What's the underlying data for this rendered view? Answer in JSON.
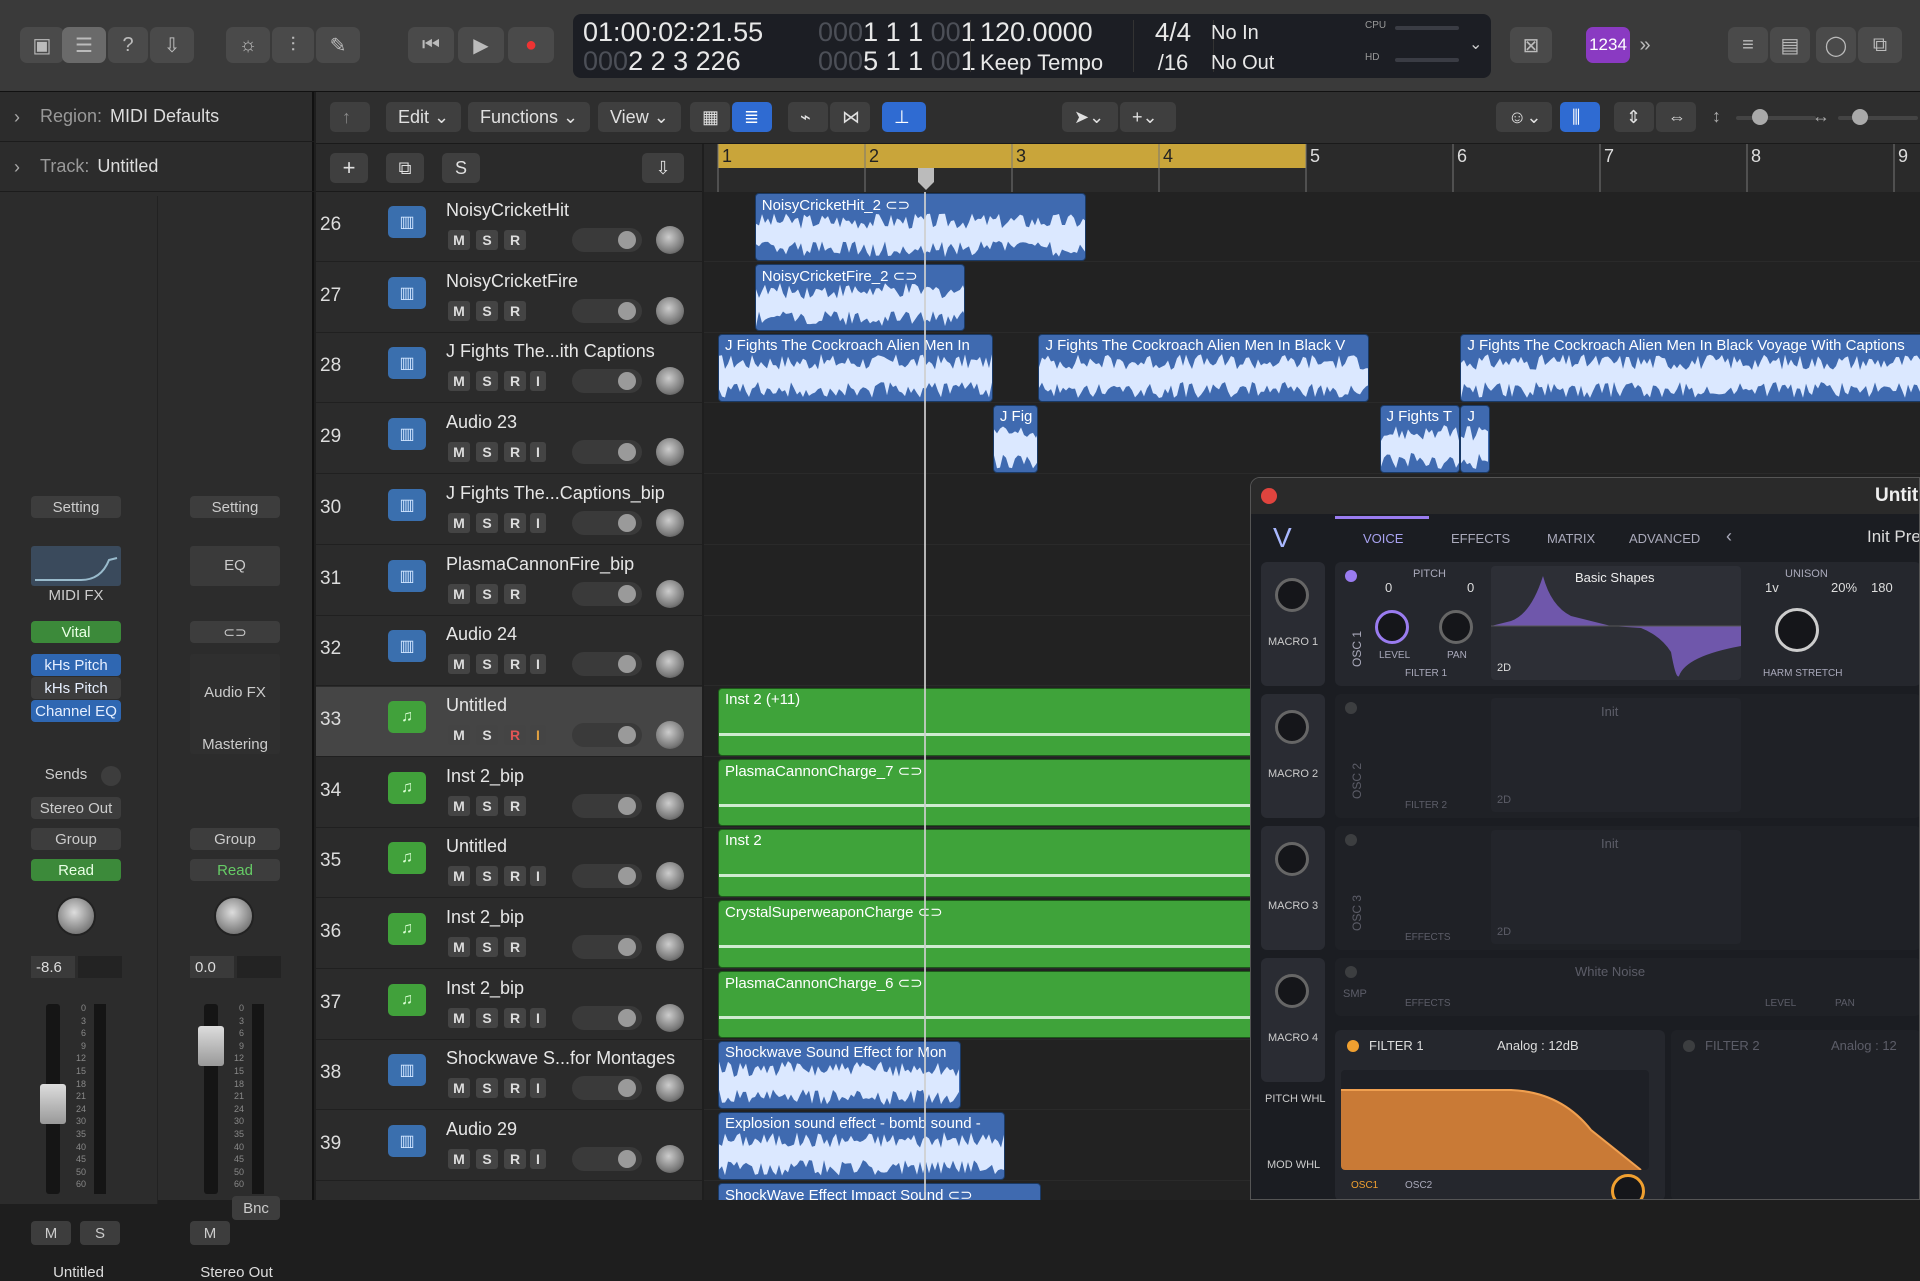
{
  "control_bar": {
    "lcd": {
      "time": "01:00:02:21.55",
      "bars": "2  2  3  226",
      "bars_dim": "000",
      "sub1": "1  1  1",
      "sub1_dim": "000",
      "sub1_end": "1",
      "sub1_end_dim": "00",
      "sub2": "5  1  1",
      "sub2_dim": "000",
      "sub2_end": "1",
      "sub2_end_dim": "00",
      "tempo": "120.0000",
      "tempo_mode": "Keep Tempo",
      "sig": "4/4",
      "div": "/16",
      "in": "No In",
      "out": "No Out",
      "cpu": "CPU",
      "hd": "HD"
    },
    "badge": "1234"
  },
  "inspector": {
    "region_label": "Region:",
    "region_value": "MIDI Defaults",
    "track_label": "Track:",
    "track_value": "Untitled",
    "strip1": {
      "setting": "Setting",
      "midi_fx": "MIDI FX",
      "instrument": "Vital",
      "fx": [
        "kHs Pitch",
        "kHs Pitch",
        "Channel EQ"
      ],
      "sends": "Sends",
      "output": "Stereo Out",
      "group": "Group",
      "automation": "Read",
      "volume": "-8.6",
      "mute": "M",
      "solo": "S",
      "name": "Untitled"
    },
    "strip2": {
      "setting": "Setting",
      "eq": "EQ",
      "audio_fx": "Audio FX",
      "mastering": "Mastering",
      "group": "Group",
      "automation": "Read",
      "volume": "0.0",
      "bounce": "Bnc",
      "mute": "M",
      "name": "Stereo Out"
    },
    "scale": [
      "0",
      "3",
      "6",
      "9",
      "12",
      "15",
      "18",
      "21",
      "24",
      "30",
      "35",
      "40",
      "45",
      "50",
      "60"
    ]
  },
  "toolbar": {
    "edit": "Edit",
    "functions": "Functions",
    "view": "View"
  },
  "track_header": {
    "add": "+",
    "solo": "S"
  },
  "ruler": [
    "1",
    "2",
    "3",
    "4",
    "5",
    "6",
    "7",
    "8",
    "9"
  ],
  "tracks": [
    {
      "num": "26",
      "name": "NoisyCricketHit",
      "type": "audio",
      "rec": "R",
      "input": ""
    },
    {
      "num": "27",
      "name": "NoisyCricketFire",
      "type": "audio",
      "rec": "R",
      "input": ""
    },
    {
      "num": "28",
      "name": "J Fights The...ith Captions",
      "type": "audio",
      "rec": "R",
      "input": "I"
    },
    {
      "num": "29",
      "name": "Audio 23",
      "type": "audio",
      "rec": "R",
      "input": "I"
    },
    {
      "num": "30",
      "name": "J Fights The...Captions_bip",
      "type": "audio",
      "rec": "R",
      "input": "I"
    },
    {
      "num": "31",
      "name": "PlasmaCannonFire_bip",
      "type": "audio",
      "rec": "R",
      "input": ""
    },
    {
      "num": "32",
      "name": "Audio 24",
      "type": "audio",
      "rec": "R",
      "input": "I"
    },
    {
      "num": "33",
      "name": "Untitled",
      "type": "midi",
      "rec": "R",
      "input": "I",
      "selected": true
    },
    {
      "num": "34",
      "name": "Inst 2_bip",
      "type": "midi",
      "rec": "R",
      "input": ""
    },
    {
      "num": "35",
      "name": "Untitled",
      "type": "midi",
      "rec": "R",
      "input": "I"
    },
    {
      "num": "36",
      "name": "Inst 2_bip",
      "type": "midi",
      "rec": "R",
      "input": ""
    },
    {
      "num": "37",
      "name": "Inst 2_bip",
      "type": "midi",
      "rec": "R",
      "input": "I"
    },
    {
      "num": "38",
      "name": "Shockwave S...for Montages",
      "type": "audio",
      "rec": "R",
      "input": "I"
    },
    {
      "num": "39",
      "name": "Audio 29",
      "type": "audio",
      "rec": "R",
      "input": "I"
    }
  ],
  "track_buttons": {
    "m": "M",
    "s": "S"
  },
  "regions": [
    {
      "lane": 0,
      "kind": "a",
      "name": "NoisyCricketHit_2 ⊂⊃",
      "start": 1.25,
      "end": 3.5
    },
    {
      "lane": 1,
      "kind": "a",
      "name": "NoisyCricketFire_2 ⊂⊃",
      "start": 1.25,
      "end": 2.68
    },
    {
      "lane": 2,
      "kind": "a",
      "name": "J Fights The Cockroach Alien  Men In",
      "start": 1.0,
      "end": 2.87
    },
    {
      "lane": 2,
      "kind": "a",
      "name": "J Fights The Cockroach Alien  Men In Black  V",
      "start": 3.18,
      "end": 5.43
    },
    {
      "lane": 2,
      "kind": "a",
      "name": "J Fights The Cockroach Alien  Men In Black  Voyage  With Captions",
      "start": 6.05,
      "end": 9.3
    },
    {
      "lane": 3,
      "kind": "a",
      "name": "J Fig",
      "start": 2.87,
      "end": 3.18
    },
    {
      "lane": 3,
      "kind": "a",
      "name": "J Fights T",
      "start": 5.5,
      "end": 6.05
    },
    {
      "lane": 3,
      "kind": "a",
      "name": "J",
      "start": 6.05,
      "end": 6.25
    },
    {
      "lane": 7,
      "kind": "m",
      "name": "Inst 2 (+11)",
      "start": 1.0,
      "end": 5.0
    },
    {
      "lane": 8,
      "kind": "m",
      "name": "PlasmaCannonCharge_7 ⊂⊃",
      "start": 1.0,
      "end": 5.0
    },
    {
      "lane": 9,
      "kind": "m",
      "name": "Inst 2",
      "start": 1.0,
      "end": 5.0
    },
    {
      "lane": 10,
      "kind": "m",
      "name": "CrystalSuperweaponCharge ⊂⊃",
      "start": 1.0,
      "end": 5.0
    },
    {
      "lane": 11,
      "kind": "m",
      "name": "PlasmaCannonCharge_6 ⊂⊃",
      "start": 1.0,
      "end": 5.0
    },
    {
      "lane": 12,
      "kind": "a",
      "name": "Shockwave Sound Effect for Mon",
      "start": 1.0,
      "end": 2.65
    },
    {
      "lane": 13,
      "kind": "a",
      "name": "Explosion sound effect - bomb sound -",
      "start": 1.0,
      "end": 2.95
    },
    {
      "lane": 14,
      "kind": "a",
      "name": "ShockWave Effect  Impact Sound ⊂⊃",
      "start": 1.0,
      "end": 3.2
    }
  ],
  "plugin": {
    "title": "Untitl",
    "tabs": [
      "VOICE",
      "EFFECTS",
      "MATRIX",
      "ADVANCED"
    ],
    "preset": "Init Pre",
    "macros": [
      "MACRO 1",
      "MACRO 2",
      "MACRO 3",
      "MACRO 4"
    ],
    "osc1": {
      "label": "OSC 1",
      "pitch": "PITCH",
      "p1": "0",
      "p2": "0",
      "level": "LEVEL",
      "pan": "PAN",
      "dest": "FILTER 1",
      "wave": "Basic Shapes",
      "mode": "2D",
      "unison": "UNISON",
      "u1": "1v",
      "u2": "20%",
      "u3": "180",
      "stretch": "HARM STRETCH"
    },
    "osc2": {
      "label": "OSC 2",
      "wave": "Init",
      "dest": "FILTER 2",
      "mode": "2D"
    },
    "osc3": {
      "label": "OSC 3",
      "wave": "Init",
      "dest": "EFFECTS",
      "mode": "2D"
    },
    "smp": {
      "label": "SMP",
      "wave": "White Noise",
      "dest": "EFFECTS",
      "level": "LEVEL",
      "pan": "PAN"
    },
    "pitch_whl": "PITCH WHL",
    "mod_whl": "MOD WHL",
    "filter1": {
      "label": "FILTER 1",
      "model": "Analog : 12dB",
      "o1": "OSC1",
      "o2": "OSC2"
    },
    "filter2": {
      "label": "FILTER 2",
      "model": "Analog : 12"
    }
  }
}
